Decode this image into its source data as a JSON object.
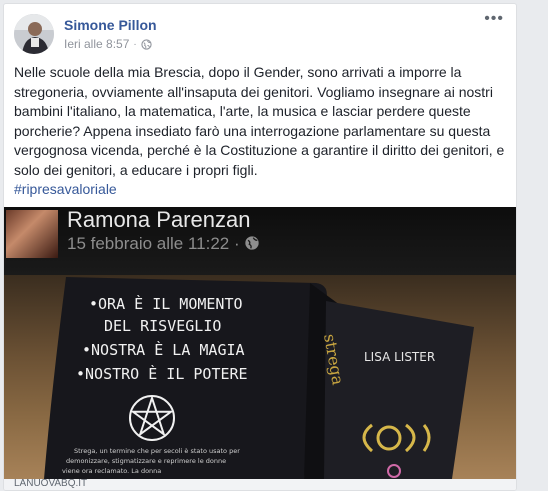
{
  "post": {
    "author": "Simone Pillon",
    "timestamp": "Ieri alle 8:57",
    "privacy_icon": "globe-icon",
    "more_icon": "more-options-icon",
    "body": "Nelle scuole della mia Brescia, dopo il Gender, sono arrivati a imporre la stregoneria, ovviamente all'insaputa dei genitori. Vogliamo insegnare ai nostri bambini l'italiano, la matematica, l'arte, la musica e lasciar perdere queste porcherie? Appena insediato farò una interrogazione parlamentare su questa vergognosa vicenda, perché è la Costituzione a garantire il diritto dei genitori, e solo dei genitori, a educare i propri figli.",
    "hashtag": "#ripresavaloriale"
  },
  "shared_image": {
    "name": "Ramona Parenzan",
    "date": "15 febbraio alle 11:22 · ",
    "book_lines": [
      "•ORA È IL MOMENTO",
      "DEL RISVEGLIO",
      "•NOSTRA È LA MAGIA",
      "•NOSTRO È IL POTERE"
    ],
    "book_author": "LISA LISTER",
    "book_spine_title": "strega",
    "book_small_text": [
      "Strega, un termine che per secoli è stato usato per",
      "demonizzare, stigmatizzare e reprimere le donne",
      "viene ora reclamato. La donna"
    ]
  },
  "footer": {
    "source": "LANUOVABQ.IT"
  },
  "colors": {
    "link_blue": "#365899",
    "text": "#1d2129",
    "meta": "#90949c",
    "background": "#e9ebee"
  }
}
